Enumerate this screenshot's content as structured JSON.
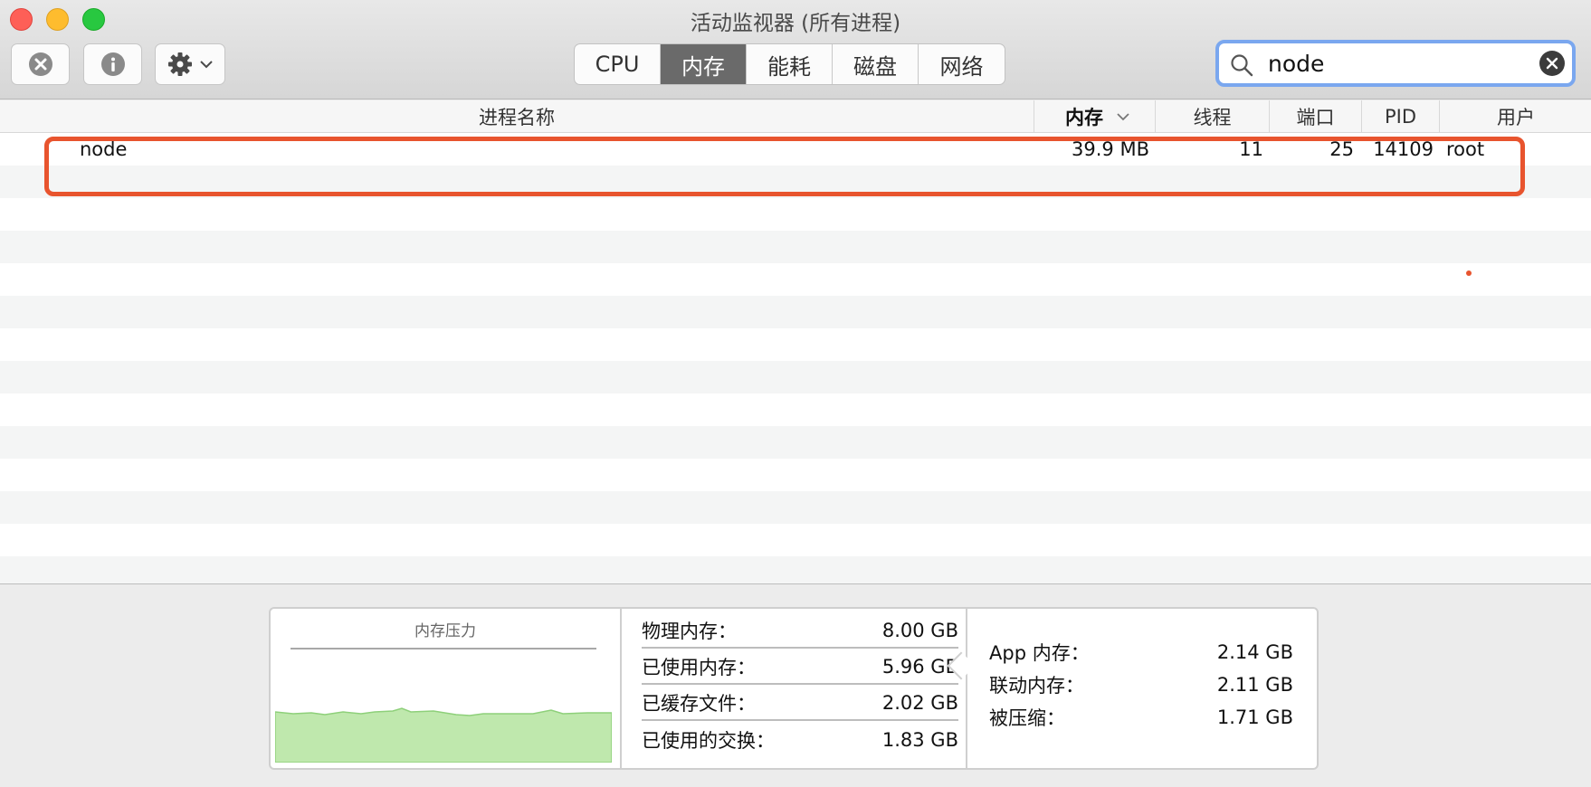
{
  "window": {
    "title": "活动监视器 (所有进程)"
  },
  "toolbar": {
    "tabs": [
      {
        "label": "CPU",
        "active": false
      },
      {
        "label": "内存",
        "active": true
      },
      {
        "label": "能耗",
        "active": false
      },
      {
        "label": "磁盘",
        "active": false
      },
      {
        "label": "网络",
        "active": false
      }
    ],
    "search": {
      "value": "node",
      "placeholder": ""
    }
  },
  "table": {
    "columns": {
      "name": "进程名称",
      "memory": "内存",
      "threads": "线程",
      "ports": "端口",
      "pid": "PID",
      "user": "用户"
    },
    "sort_column": "memory",
    "rows": [
      {
        "name": "node",
        "memory": "39.9 MB",
        "threads": "11",
        "ports": "25",
        "pid": "14109",
        "user": "root"
      }
    ]
  },
  "memory_panel": {
    "pressure_title": "内存压力",
    "pressure_color": "#b9e6a6",
    "stats_left": [
      {
        "label": "物理内存：",
        "value": "8.00 GB"
      },
      {
        "label": "已使用内存：",
        "value": "5.96 GB"
      },
      {
        "label": "已缓存文件：",
        "value": "2.02 GB"
      },
      {
        "label": "已使用的交换：",
        "value": "1.83 GB"
      }
    ],
    "stats_right": [
      {
        "label": "App 内存：",
        "value": "2.14 GB"
      },
      {
        "label": "联动内存：",
        "value": "2.11 GB"
      },
      {
        "label": "被压缩：",
        "value": "1.71 GB"
      }
    ]
  },
  "colors": {
    "highlight": "#e8542e",
    "active_tab": "#6a6a6a",
    "search_focus": "#7aa7ef"
  }
}
